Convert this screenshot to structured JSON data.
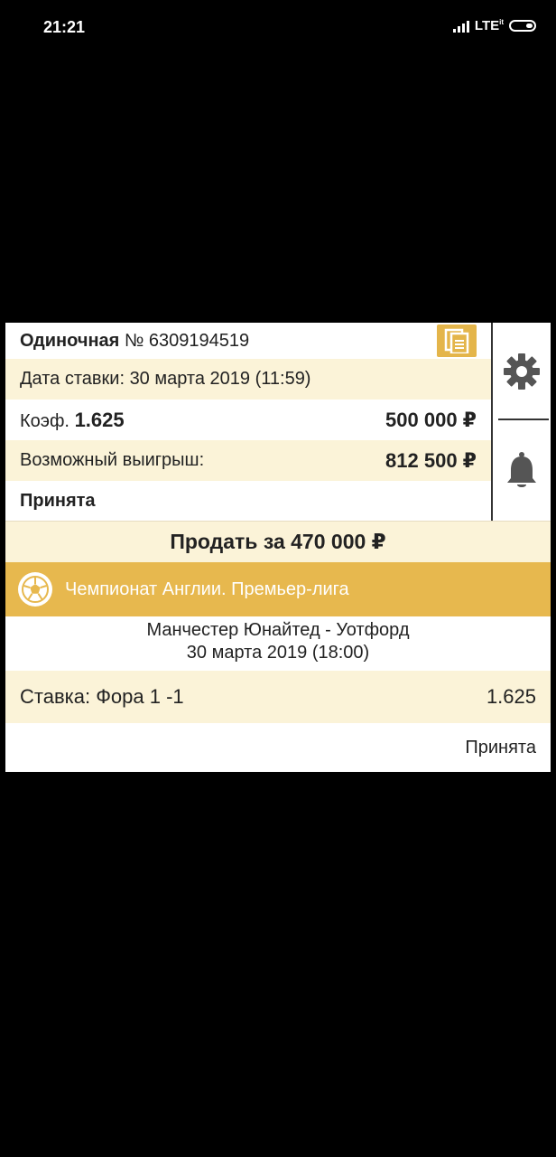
{
  "status_bar": {
    "time": "21:21",
    "network": "LTE",
    "network_sup": "it"
  },
  "bet": {
    "type": "Одиночная",
    "number": "№ 6309194519",
    "date": "Дата ставки: 30 марта 2019 (11:59)",
    "coef_label": "Коэф.",
    "coef_value": "1.625",
    "stake": "500 000 ₽",
    "possible_win_label": "Возможный выигрыш:",
    "possible_win_value": "812 500 ₽",
    "status": "Принята",
    "sell_label": "Продать за 470 000 ₽"
  },
  "event": {
    "league": "Чемпионат Англии. Премьер-лига",
    "match": "Манчестер Юнайтед - Уотфорд",
    "date": "30 марта 2019 (18:00)",
    "bet_label": "Ставка: Фора 1 -1",
    "bet_coef": "1.625",
    "status": "Принята"
  },
  "icons": {
    "doc": "document-icon",
    "gear": "gear-icon",
    "bell": "bell-icon",
    "ball": "soccer-ball-icon"
  },
  "colors": {
    "accent": "#e4b54a",
    "row_alt": "#fbf3d8",
    "icon_gray": "#555555"
  }
}
